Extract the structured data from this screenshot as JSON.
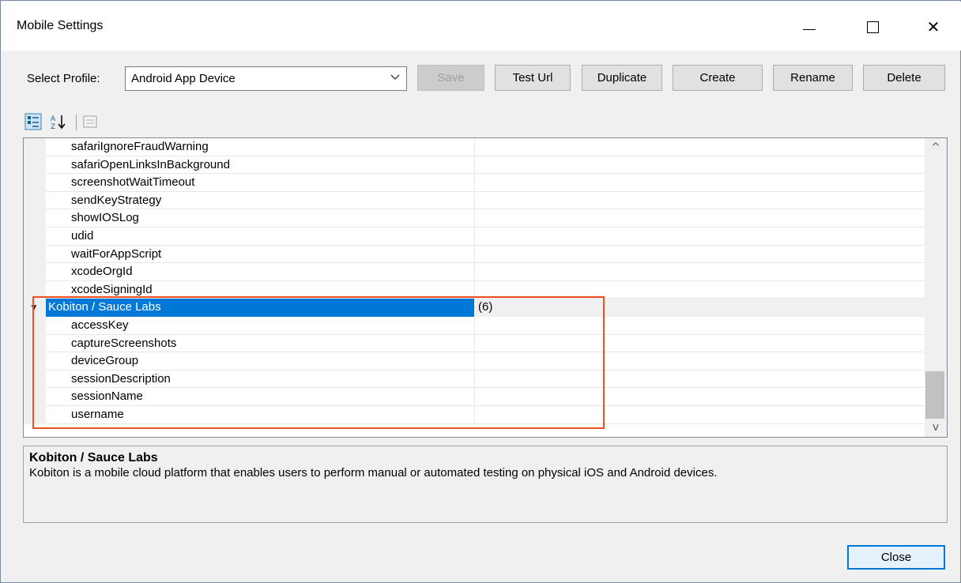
{
  "window": {
    "title": "Mobile Settings"
  },
  "profile": {
    "label": "Select Profile:",
    "selected": "Android App Device"
  },
  "buttons": {
    "save": "Save",
    "test_url": "Test Url",
    "duplicate": "Duplicate",
    "create": "Create",
    "rename": "Rename",
    "delete": "Delete",
    "close": "Close"
  },
  "grid": {
    "properties_top": [
      "safariIgnoreFraudWarning",
      "safariOpenLinksInBackground",
      "screenshotWaitTimeout",
      "sendKeyStrategy",
      "showIOSLog",
      "udid",
      "waitForAppScript",
      "xcodeOrgId",
      "xcodeSigningId"
    ],
    "category": {
      "name": "Kobiton / Sauce Labs",
      "count": "(6)"
    },
    "properties_category": [
      "accessKey",
      "captureScreenshots",
      "deviceGroup",
      "sessionDescription",
      "sessionName",
      "username"
    ]
  },
  "help": {
    "title": "Kobiton / Sauce Labs",
    "description": "Kobiton is a mobile cloud platform that enables users to perform manual or automated testing on physical iOS and Android devices."
  },
  "colors": {
    "selection": "#0078d7",
    "highlight_box": "#f04e23"
  }
}
